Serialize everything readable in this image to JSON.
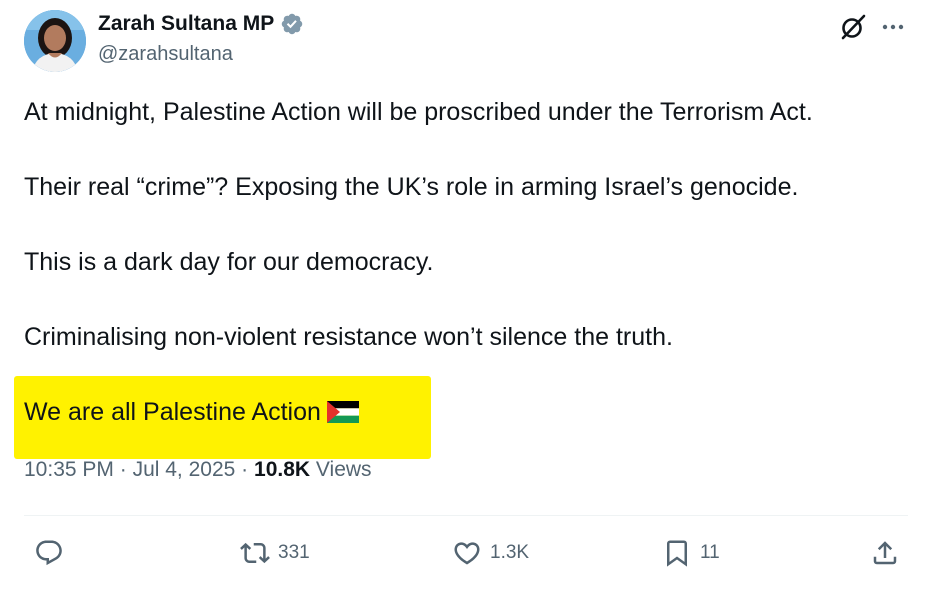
{
  "author": {
    "display_name": "Zarah Sultana MP",
    "handle": "@zarahsultana",
    "verified": true,
    "verified_badge_color": "#829aab"
  },
  "header_icons": {
    "grok": "grok-icon",
    "more": "more-icon"
  },
  "tweet": {
    "paragraphs": [
      "At midnight, Palestine Action will be proscribed under the Terrorism Act.",
      "Their real “crime”? Exposing the UK’s role in arming Israel’s genocide.",
      "This is a dark day for our democracy.",
      "Criminalising non-violent resistance won’t silence the truth.",
      "We are all Palestine Action"
    ],
    "highlight_color": "#fff200",
    "emoji": "palestine-flag-icon"
  },
  "meta": {
    "time": "10:35 PM",
    "separator": "·",
    "date": "Jul 4, 2025",
    "views_count": "10.8K",
    "views_label": "Views"
  },
  "actions": {
    "reply_count": "",
    "repost_count": "331",
    "like_count": "1.3K",
    "bookmark_count": "11"
  },
  "colors": {
    "text_primary": "#0f1419",
    "text_secondary": "#536471",
    "divider": "#eff3f4"
  }
}
